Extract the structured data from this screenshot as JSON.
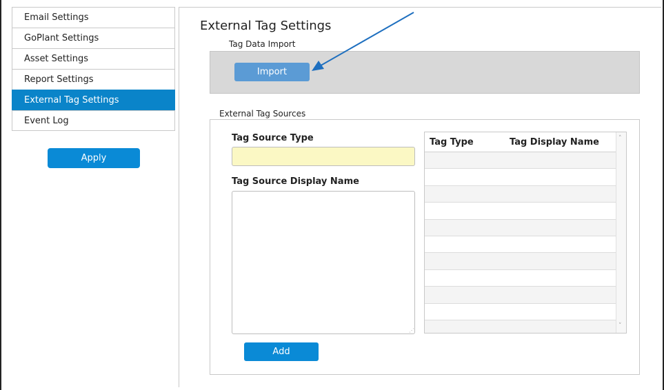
{
  "sidebar": {
    "items": [
      {
        "label": "Email Settings",
        "active": false
      },
      {
        "label": "GoPlant Settings",
        "active": false
      },
      {
        "label": "Asset Settings",
        "active": false
      },
      {
        "label": "Report Settings",
        "active": false
      },
      {
        "label": "External Tag Settings",
        "active": true
      },
      {
        "label": "Event Log",
        "active": false
      }
    ],
    "apply_label": "Apply"
  },
  "main": {
    "title": "External Tag Settings",
    "import_section": {
      "caption": "Tag Data Import",
      "button_label": "Import"
    },
    "sources_section": {
      "caption": "External Tag Sources",
      "type_label": "Tag Source Type",
      "type_value": "",
      "name_label": "Tag Source Display Name",
      "name_value": "",
      "add_label": "Add",
      "table": {
        "columns": [
          "Tag Type",
          "Tag Display Name"
        ],
        "rows": []
      }
    }
  },
  "colors": {
    "accent": "#0a84c9",
    "button_blue": "#0a8ad6",
    "import_button": "#5b9bd5",
    "import_panel": "#d8d8d8",
    "type_input_bg": "#fbf8c4",
    "annotation_arrow": "#1e6fbf"
  },
  "icons": {
    "scroll_up": "chevron-up-icon",
    "scroll_down": "chevron-down-icon",
    "resize": "resize-grip-icon"
  }
}
